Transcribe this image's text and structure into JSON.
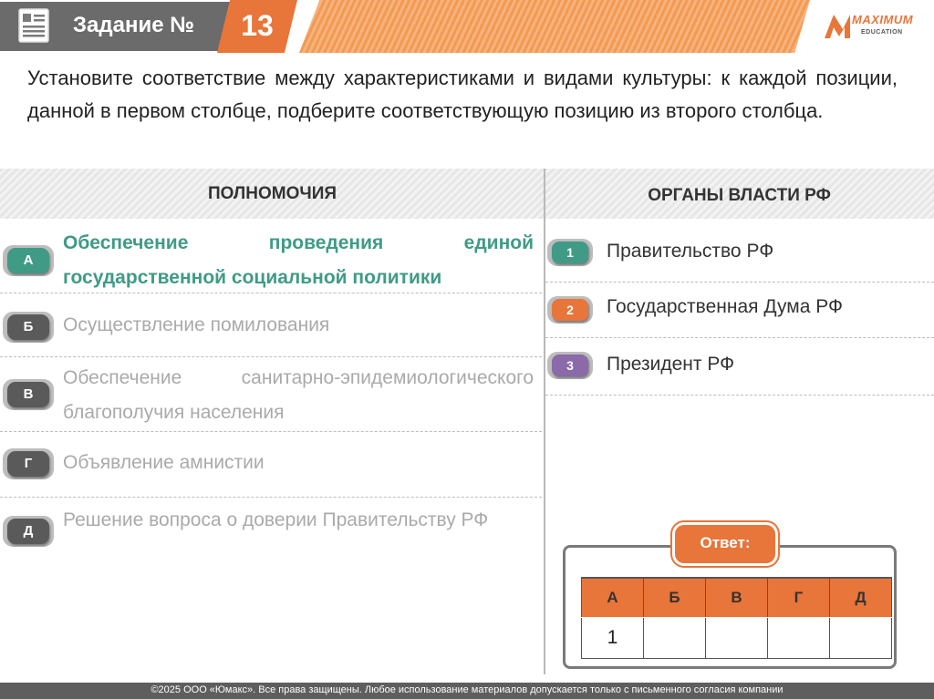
{
  "header": {
    "task_label": "Задание №",
    "task_number": "13",
    "logo_text": "MAXIMUM",
    "logo_sub": "EDUCATION",
    "icons": [
      "document-icon"
    ]
  },
  "instruction": "Установите соответствие между характеристиками и видами культуры: к каждой позиции, данной в первом столбце, подберите соответствующую позицию из второго столбца.",
  "columns": {
    "left_title": "ПОЛНОМОЧИЯ",
    "right_title": "ОРГАНЫ ВЛАСТИ РФ"
  },
  "left_items": [
    {
      "letter": "А",
      "text": "Обеспечение проведения единой государственной социальной политики",
      "color": "#3f9b86"
    },
    {
      "letter": "Б",
      "text": "Осуществление помилования",
      "color": "#5a5a5a"
    },
    {
      "letter": "В",
      "text": "Обеспечение санитарно-эпидемиологического благополучия населения",
      "color": "#5a5a5a"
    },
    {
      "letter": "Г",
      "text": "Объявление амнистии",
      "color": "#5a5a5a"
    },
    {
      "letter": "Д",
      "text": "Решение вопроса о доверии Правительству РФ",
      "color": "#5a5a5a"
    }
  ],
  "right_items": [
    {
      "number": "1",
      "text": "Правительство РФ",
      "color": "#3f9b86"
    },
    {
      "number": "2",
      "text": "Государственная Дума РФ",
      "color": "#e8753a"
    },
    {
      "number": "3",
      "text": "Президент РФ",
      "color": "#8a6aa8"
    }
  ],
  "answer": {
    "label": "Ответ:",
    "headers": [
      "А",
      "Б",
      "В",
      "Г",
      "Д"
    ],
    "values": [
      "1",
      "",
      "",
      "",
      ""
    ]
  },
  "footer": "©2025 ООО «Юмакс». Все права защищены. Любое использование материалов допускается только с  письменного согласия компании",
  "colors": {
    "accent": "#e8753a",
    "header_grey": "#6b6b6b",
    "active_green": "#3f9b86"
  }
}
